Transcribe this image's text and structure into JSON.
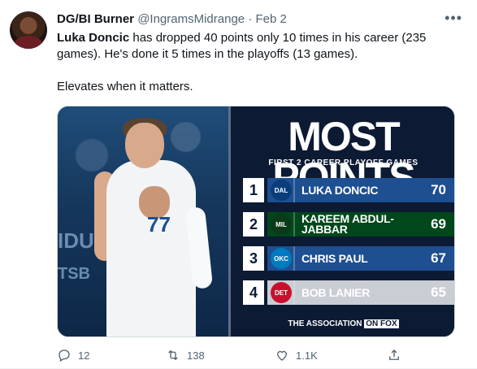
{
  "tweet": {
    "display_name": "DG/BI Burner",
    "handle": "@IngramsMidrange",
    "separator": "·",
    "date": "Feb 2",
    "text_line1_bold": "Luka Doncic",
    "text_line1_rest": " has dropped 40 points only 10 times in his career (235 games). He's done it 5 times in the playoffs (13 games).",
    "text_line2": "Elevates when it matters."
  },
  "graphic": {
    "title": "MOST POINTS",
    "subtitle": "FIRST 2 CAREER PLAYOFF GAMES",
    "footer": "THE ASSOCIATION",
    "footer_brand": "ON FOX",
    "photo_texts": [
      "IDU",
      "TSB"
    ],
    "jersey_number": "77",
    "rows": [
      {
        "rank": "1",
        "player": "LUKA DONCIC",
        "points": "70",
        "logo": "DAL",
        "bar_color": "#1d4f91",
        "logo_color": "#0b3d7a"
      },
      {
        "rank": "2",
        "player": "KAREEM ABDUL-JABBAR",
        "points": "69",
        "logo": "MIL",
        "bar_color": "#00471b",
        "logo_color": "#0b3a1a"
      },
      {
        "rank": "3",
        "player": "CHRIS PAUL",
        "points": "67",
        "logo": "OKC",
        "bar_color": "#1d4f91",
        "logo_color": "#007ac1"
      },
      {
        "rank": "4",
        "player": "BOB LANIER",
        "points": "65",
        "logo": "DET",
        "bar_color": "#c9cdd4",
        "logo_color": "#c8102e"
      }
    ]
  },
  "actions": {
    "reply_count": "12",
    "retweet_count": "138",
    "like_count": "1.1K"
  },
  "icons": [
    "more-icon",
    "reply-icon",
    "retweet-icon",
    "like-icon",
    "share-icon"
  ]
}
